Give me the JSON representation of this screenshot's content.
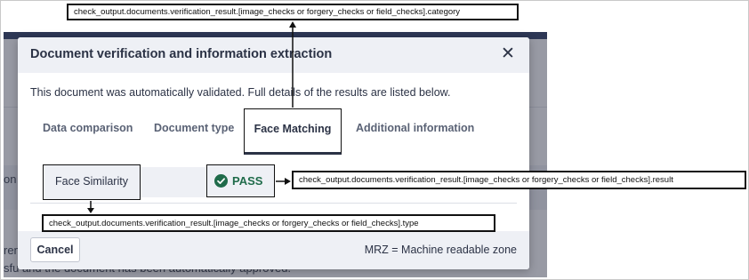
{
  "background_page": {
    "fragment_left": "on",
    "fragment_bottom_1": "ren",
    "fragment_bottom_2": "sfu and the document has been automatically approved."
  },
  "modal": {
    "title": "Document verification and information extraction",
    "close_icon": "close-icon",
    "intro": "This document was automatically validated. Full details of the results are listed below.",
    "tabs": [
      {
        "label": "Data comparison",
        "active": false
      },
      {
        "label": "Document type",
        "active": false
      },
      {
        "label": "Face Matching",
        "active": true
      },
      {
        "label": "Additional information",
        "active": false
      }
    ],
    "check": {
      "label": "Face Similarity",
      "result": "PASS",
      "result_icon": "check-circle-icon",
      "result_color": "#1f6b4a"
    },
    "footer": {
      "cancel_label": "Cancel",
      "note": "MRZ = Machine readable zone"
    }
  },
  "annotations": {
    "category": "check_output.documents.verification_result.[image_checks or forgery_checks or field_checks].category",
    "result": "check_output.documents.verification_result.[image_checks or forgery_checks or field_checks].result",
    "type": "check_output.documents.verification_result.[image_checks or forgery_checks or field_checks].type"
  }
}
